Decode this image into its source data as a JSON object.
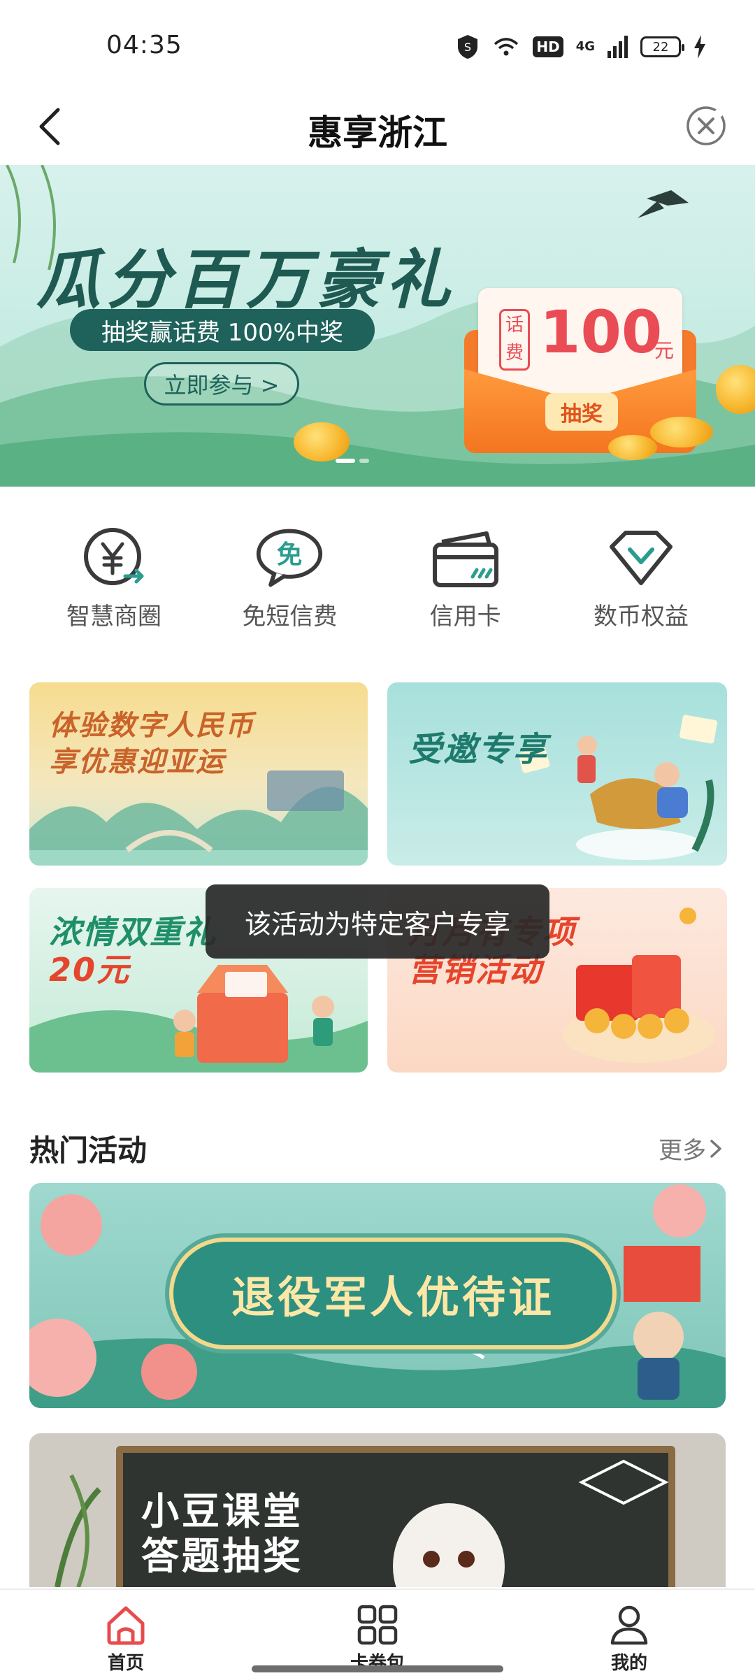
{
  "status_bar": {
    "time": "04:35",
    "network": "4G",
    "hd_label": "HD",
    "battery": "22"
  },
  "header": {
    "title": "惠享浙江"
  },
  "hero": {
    "title": "瓜分百万豪礼",
    "pill": "抽奖赢话费 100%中奖",
    "cta": "立即参与 >",
    "envelope_tag": "话费",
    "envelope_amount": "100",
    "envelope_unit": "元",
    "envelope_button": "抽奖"
  },
  "quick_menu": [
    {
      "label": "智慧商圈",
      "icon": "yuan-coin-icon"
    },
    {
      "label": "免短信费",
      "icon": "free-sms-icon",
      "badge": "免"
    },
    {
      "label": "信用卡",
      "icon": "credit-card-icon"
    },
    {
      "label": "数币权益",
      "icon": "diamond-icon"
    }
  ],
  "promos": [
    {
      "line1": "体验数字人民币",
      "line2": "享优惠迎亚运"
    },
    {
      "line1": "受邀专享"
    },
    {
      "line1": "浓情双重礼",
      "line2": "20元"
    },
    {
      "line1": "月月有专项",
      "line2": "营销活动"
    }
  ],
  "toast": "该活动为特定客户专享",
  "hot": {
    "title": "热门活动",
    "more": "更多",
    "banner1": "退役军人优待证",
    "banner2_line1": "小豆课堂",
    "banner2_line2": "答题抽奖"
  },
  "bottom_nav": [
    {
      "label": "首页",
      "icon": "home-icon",
      "active": true
    },
    {
      "label": "卡券包",
      "icon": "grid-icon",
      "active": false
    },
    {
      "label": "我的",
      "icon": "person-icon",
      "active": false
    }
  ],
  "colors": {
    "accent": "#e74c4c",
    "teal": "#1e625b",
    "text_gray": "#555555"
  }
}
